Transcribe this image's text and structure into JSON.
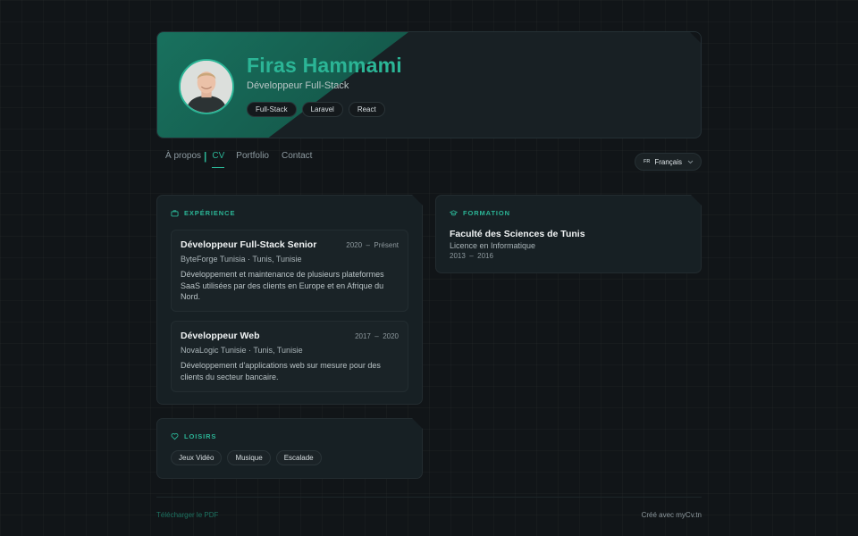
{
  "profile": {
    "name": "Firas Hammami",
    "role": "Développeur Full-Stack",
    "tags": [
      "Full-Stack",
      "Laravel",
      "React"
    ]
  },
  "nav": {
    "items": [
      "À propos",
      "CV",
      "Portfolio",
      "Contact"
    ],
    "active": "CV"
  },
  "language": {
    "code": "FR",
    "label": "Français"
  },
  "experience": {
    "title": "EXPÉRIENCE",
    "items": [
      {
        "title": "Développeur Full-Stack Senior",
        "start": "2020",
        "end": "Présent",
        "company": "ByteForge Tunisia · Tunis, Tunisie",
        "description": "Développement et maintenance de plusieurs plateformes SaaS utilisées par des clients en Europe et en Afrique du Nord."
      },
      {
        "title": "Développeur Web",
        "start": "2017",
        "end": "2020",
        "company": "NovaLogic Tunisie · Tunis, Tunisie",
        "description": "Développement d'applications web sur mesure pour des clients du secteur bancaire."
      }
    ]
  },
  "hobbies": {
    "title": "LOISIRS",
    "items": [
      "Jeux Vidéo",
      "Musique",
      "Escalade"
    ]
  },
  "education": {
    "title": "FORMATION",
    "items": [
      {
        "school": "Faculté des Sciences de Tunis",
        "degree": "Licence en Informatique",
        "start": "2013",
        "end": "2016"
      }
    ]
  },
  "footer": {
    "download": "Télécharger le PDF",
    "credit": "Créé avec myCv.tn"
  },
  "colors": {
    "accent": "#2bb596",
    "background": "#111518",
    "card": "#172024"
  }
}
